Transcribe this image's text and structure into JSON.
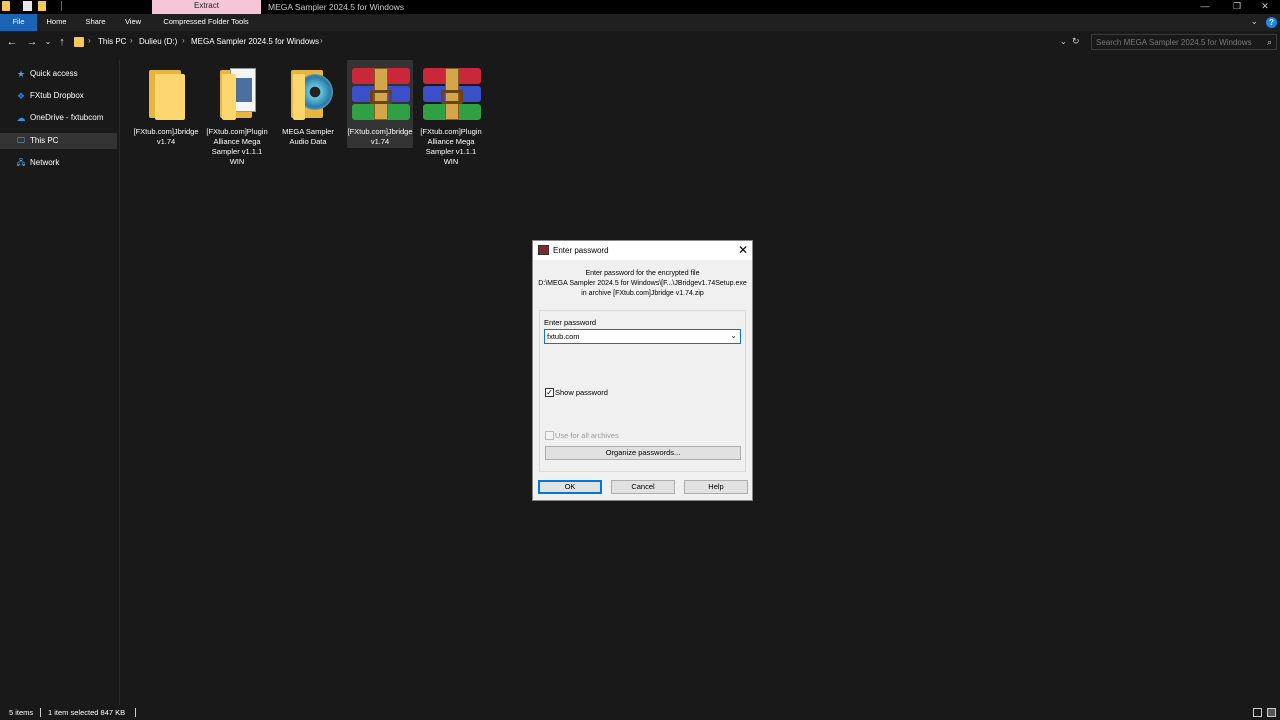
{
  "window": {
    "title": "MEGA Sampler 2024.5 for Windows",
    "contextual_tab": "Extract",
    "controls": {
      "minimize": "—",
      "restore": "❐",
      "close": "✕"
    }
  },
  "ribbon": {
    "tabs": [
      "File",
      "Home",
      "Share",
      "View",
      "Compressed Folder Tools"
    ],
    "help": "?",
    "collapse_chevron": "⌄"
  },
  "nav": {
    "back": "←",
    "forward": "→",
    "recent": "⌄",
    "up": "↑"
  },
  "address": {
    "crumbs": [
      "This PC",
      "Dulieu (D:)",
      "MEGA Sampler 2024.5 for Windows"
    ],
    "separator": "›",
    "dropdown": "⌄",
    "refresh": "↻"
  },
  "search": {
    "placeholder": "Search MEGA Sampler 2024.5 for Windows",
    "icon": "⌕"
  },
  "sidebar": {
    "items": [
      {
        "label": "Quick access",
        "icon": "star-icon",
        "glyph": "★",
        "color": "#4aa3f0"
      },
      {
        "label": "FXtub Dropbox",
        "icon": "dropbox-icon",
        "glyph": "❖",
        "color": "#2f80ed"
      },
      {
        "label": "OneDrive - fxtubcom",
        "icon": "cloud-icon",
        "glyph": "☁",
        "color": "#3d8fdc"
      },
      {
        "label": "This PC",
        "icon": "computer-icon",
        "glyph": "🖵",
        "color": "#6ab4f0"
      },
      {
        "label": "Network",
        "icon": "network-icon",
        "glyph": "🖧",
        "color": "#6ab4f0"
      }
    ],
    "selected": "This PC"
  },
  "files": [
    {
      "name": "[FXtub.com]Jbridge v1.74",
      "type": "folder",
      "icon": "folder-icon"
    },
    {
      "name": "[FXtub.com]Plugin Alliance Mega Sampler v1.1.1 WIN",
      "type": "folder-doc",
      "icon": "folder-document-icon"
    },
    {
      "name": "MEGA Sampler Audio Data",
      "type": "folder-cd",
      "icon": "folder-disc-icon"
    },
    {
      "name": "[FXtub.com]Jbridge v1.74",
      "type": "rar",
      "icon": "winrar-archive-icon",
      "selected": true
    },
    {
      "name": "[FXtub.com]Plugin Alliance Mega Sampler v1.1.1 WIN",
      "type": "rar",
      "icon": "winrar-archive-icon"
    }
  ],
  "dialog": {
    "title": "Enter password",
    "close": "✕",
    "line1": "Enter password for the encrypted file",
    "line2": "D:\\MEGA Sampler 2024.5 for Windows\\[F...\\JBridgev1.74Setup.exe",
    "line3": "in archive [FXtub.com]Jbridge v1.74.zip",
    "field_label": "Enter password",
    "password_value": "fxtub.com",
    "dropdown": "⌄",
    "show_password_label": "Show password",
    "show_password_checked": true,
    "check_mark": "✓",
    "all_archives_label": "Use for all archives",
    "organize_label": "Organize passwords...",
    "ok_label": "OK",
    "cancel_label": "Cancel",
    "help_label": "Help"
  },
  "status": {
    "items_count": "5 items",
    "selection": "1 item selected  847 KB"
  },
  "colors": {
    "background": "#191919",
    "file_tab": "#1b64b3",
    "extract_tab": "#f4c6d8",
    "accent": "#0078d7"
  }
}
